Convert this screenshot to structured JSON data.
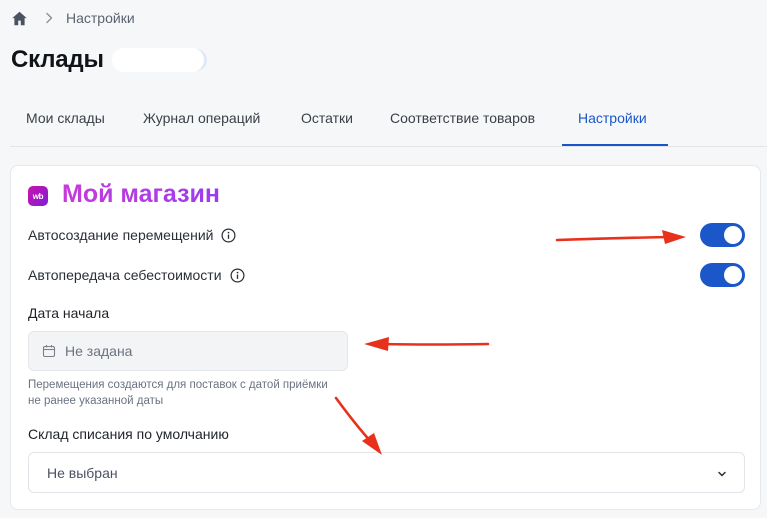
{
  "breadcrumb": {
    "home_icon": "home-icon",
    "separator_icon": "chevron-right-icon",
    "current": "Настройки"
  },
  "page": {
    "title": "Склады"
  },
  "tabs": [
    {
      "label": "Мои склады",
      "active": false
    },
    {
      "label": "Журнал операций",
      "active": false
    },
    {
      "label": "Остатки",
      "active": false
    },
    {
      "label": "Соответствие товаров",
      "active": false
    },
    {
      "label": "Настройки",
      "active": true
    }
  ],
  "card": {
    "logo_text": "wb",
    "shop_name": "Мой магазин",
    "auto_transfers": {
      "label": "Автосоздание перемещений",
      "enabled": true
    },
    "auto_cost": {
      "label": "Автопередача себестоимости",
      "enabled": true
    },
    "start_date": {
      "label": "Дата начала",
      "placeholder": "Не задана",
      "hint": "Перемещения создаются для поставок с датой приёмки не ранее указанной даты"
    },
    "writeoff_warehouse": {
      "label": "Склад списания по умолчанию",
      "value": "Не выбран"
    }
  },
  "colors": {
    "accent": "#1b56c9",
    "toggle_on": "#1c57c9",
    "brand_gradient_start": "#cb11ab",
    "brand_gradient_end": "#7d1fd7",
    "annotation_arrow": "#e8311c"
  }
}
